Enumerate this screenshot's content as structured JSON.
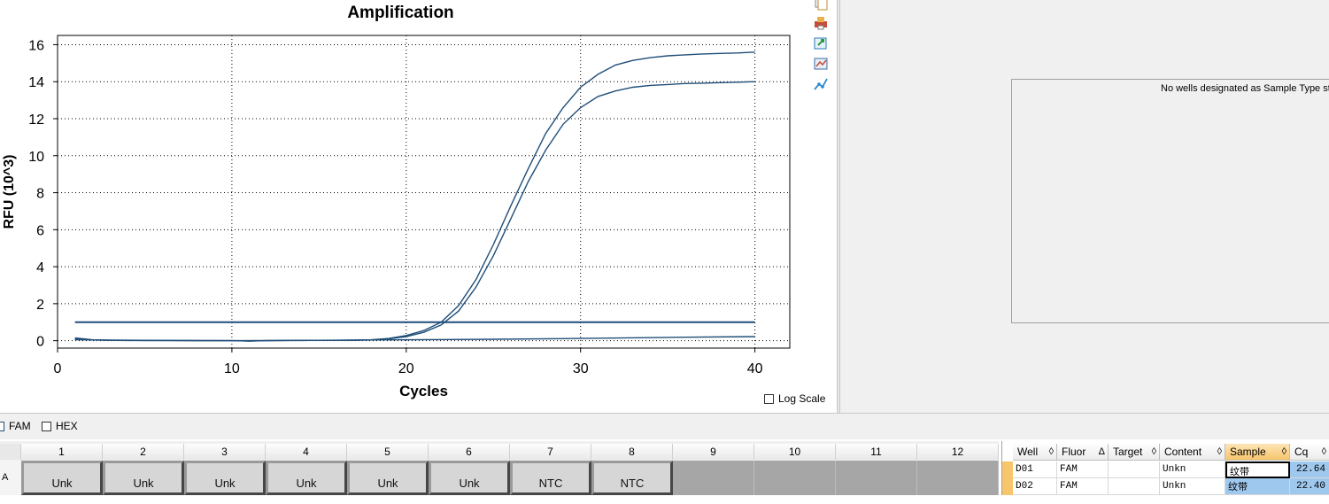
{
  "chart_data": {
    "type": "line",
    "title": "Amplification",
    "xlabel": "Cycles",
    "ylabel": "RFU (10^3)",
    "xlim": [
      0,
      42
    ],
    "ylim": [
      -0.4,
      16.5
    ],
    "xticks": [
      0,
      10,
      20,
      30,
      40
    ],
    "yticks": [
      0,
      2,
      4,
      6,
      8,
      10,
      12,
      14,
      16
    ],
    "grid": true,
    "threshold": 1.0,
    "series": [
      {
        "color": "#1f4e79",
        "x": [
          1,
          2,
          3,
          4,
          5,
          6,
          7,
          8,
          9,
          10,
          11,
          12,
          13,
          14,
          15,
          16,
          17,
          18,
          19,
          20,
          21,
          22,
          23,
          24,
          25,
          26,
          27,
          28,
          29,
          30,
          31,
          32,
          33,
          34,
          35,
          36,
          37,
          38,
          39,
          40
        ],
        "y": [
          0.15,
          0.05,
          0.02,
          0.02,
          0.01,
          0.01,
          0.01,
          0.0,
          0.0,
          0.0,
          -0.02,
          0.0,
          0.01,
          0.02,
          0.02,
          0.02,
          0.03,
          0.05,
          0.12,
          0.28,
          0.55,
          1.0,
          1.9,
          3.3,
          5.2,
          7.3,
          9.3,
          11.2,
          12.6,
          13.7,
          14.4,
          14.9,
          15.15,
          15.3,
          15.4,
          15.45,
          15.5,
          15.53,
          15.55,
          15.6
        ]
      },
      {
        "color": "#1f4e79",
        "x": [
          1,
          2,
          3,
          4,
          5,
          6,
          7,
          8,
          9,
          10,
          11,
          12,
          13,
          14,
          15,
          16,
          17,
          18,
          19,
          20,
          21,
          22,
          23,
          24,
          25,
          26,
          27,
          28,
          29,
          30,
          31,
          32,
          33,
          34,
          35,
          36,
          37,
          38,
          39,
          40
        ],
        "y": [
          0.1,
          0.04,
          0.02,
          0.01,
          0.01,
          0.01,
          0.0,
          0.0,
          0.0,
          0.0,
          -0.02,
          0.0,
          0.01,
          0.01,
          0.02,
          0.02,
          0.02,
          0.04,
          0.1,
          0.22,
          0.45,
          0.85,
          1.6,
          2.9,
          4.6,
          6.6,
          8.6,
          10.3,
          11.7,
          12.6,
          13.2,
          13.5,
          13.7,
          13.8,
          13.85,
          13.9,
          13.92,
          13.95,
          13.97,
          14.0
        ]
      },
      {
        "color": "#1f4e79",
        "x": [
          1,
          5,
          10,
          15,
          20,
          25,
          30,
          35,
          40
        ],
        "y": [
          0.05,
          0.02,
          0.0,
          0.02,
          0.05,
          0.08,
          0.12,
          0.18,
          0.22
        ]
      }
    ]
  },
  "log_scale_label": "Log Scale",
  "right_panel": {
    "message": "No wells designated as Sample Type sta"
  },
  "fluor_filters": [
    {
      "label": "FAM",
      "checked": true
    },
    {
      "label": "HEX",
      "checked": false
    }
  ],
  "plate": {
    "columns": [
      "1",
      "2",
      "3",
      "4",
      "5",
      "6",
      "7",
      "8",
      "9",
      "10",
      "11",
      "12"
    ],
    "row_label": "A",
    "wells": [
      "Unk",
      "Unk",
      "Unk",
      "Unk",
      "Unk",
      "Unk",
      "NTC",
      "NTC",
      "",
      "",
      "",
      ""
    ]
  },
  "table": {
    "headers": [
      {
        "label": "Well",
        "sort": "◊"
      },
      {
        "label": "Fluor",
        "sort": "Δ"
      },
      {
        "label": "Target",
        "sort": "◊"
      },
      {
        "label": "Content",
        "sort": "◊"
      },
      {
        "label": "Sample",
        "sort": "◊"
      },
      {
        "label": "Cq",
        "sort": "◊"
      }
    ],
    "rows": [
      {
        "well": "D01",
        "fluor": "FAM",
        "target": "",
        "content": "Unkn",
        "sample": "纹带",
        "cq": "22.64"
      },
      {
        "well": "D02",
        "fluor": "FAM",
        "target": "",
        "content": "Unkn",
        "sample": "纹带",
        "cq": "22.40"
      }
    ]
  }
}
